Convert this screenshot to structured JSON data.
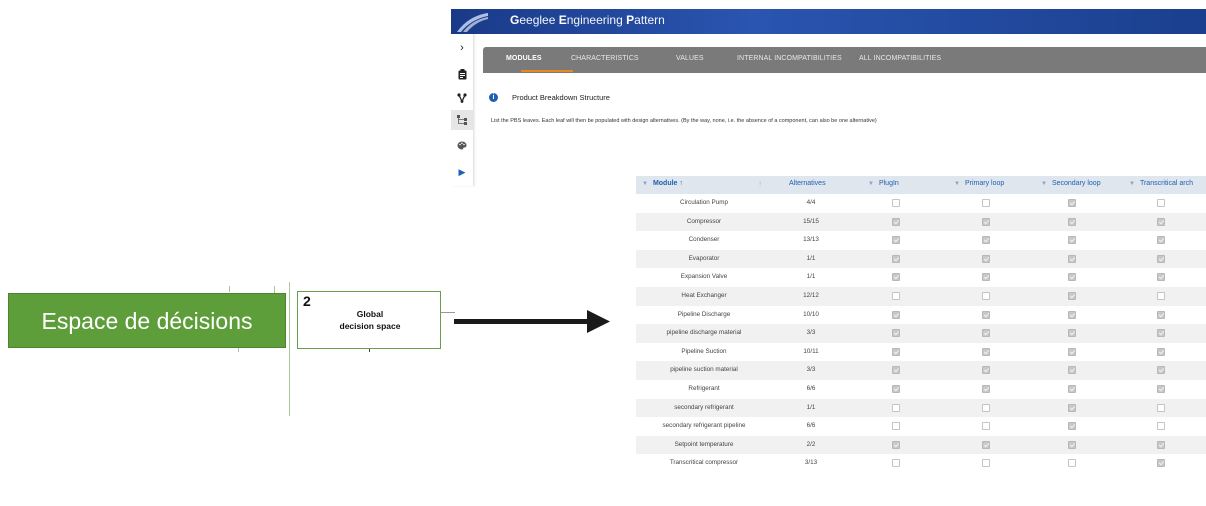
{
  "app": {
    "title_bold_1": "G",
    "title_rest_1": "eeglee ",
    "title_bold_2": "E",
    "title_rest_2": "ngineering ",
    "title_bold_3": "P",
    "title_rest_3": "attern",
    "brand_color": "#1f3f8a"
  },
  "sidebar": {
    "items": [
      {
        "icon": "chevron-right-icon",
        "glyph": "›"
      },
      {
        "icon": "clipboard-icon",
        "glyph": ""
      },
      {
        "icon": "fork-icon",
        "glyph": ""
      },
      {
        "icon": "tree-structure-icon",
        "glyph": ""
      },
      {
        "icon": "palette-icon",
        "glyph": ""
      },
      {
        "icon": "play-icon",
        "glyph": "▶"
      }
    ]
  },
  "tabs": [
    {
      "label": "MODULES",
      "active": true
    },
    {
      "label": "CHARACTERISTICS",
      "active": false
    },
    {
      "label": "VALUES",
      "active": false
    },
    {
      "label": "INTERNAL INCOMPATIBILITIES",
      "active": false
    },
    {
      "label": "ALL INCOMPATIBILITIES",
      "active": false
    }
  ],
  "section": {
    "info_glyph": "i",
    "title": "Product Breakdown Structure",
    "description": "List the PBS leaves. Each leaf will then be populated with design alternatives. (By the way, none, i.e. the absence of a component, can also be one alternative)"
  },
  "grid": {
    "headers": {
      "module": "Module ↑",
      "alternatives": "Alternatives",
      "plugin": "PlugIn",
      "primary": "Primary loop",
      "secondary": "Secondary loop",
      "transcritical": "Transcritical arch"
    },
    "filter_glyph": "▼",
    "sort_glyph": "⁝",
    "rows": [
      {
        "module": "Circulation Pump",
        "alt": "4/4",
        "plugin": false,
        "primary": false,
        "secondary": true,
        "trans": false
      },
      {
        "module": "Compressor",
        "alt": "15/15",
        "plugin": true,
        "primary": true,
        "secondary": true,
        "trans": true
      },
      {
        "module": "Condenser",
        "alt": "13/13",
        "plugin": true,
        "primary": true,
        "secondary": true,
        "trans": true
      },
      {
        "module": "Evaporator",
        "alt": "1/1",
        "plugin": true,
        "primary": true,
        "secondary": true,
        "trans": true
      },
      {
        "module": "Expansion Valve",
        "alt": "1/1",
        "plugin": true,
        "primary": true,
        "secondary": true,
        "trans": true
      },
      {
        "module": "Heat Exchanger",
        "alt": "12/12",
        "plugin": false,
        "primary": false,
        "secondary": true,
        "trans": false
      },
      {
        "module": "Pipeline Discharge",
        "alt": "10/10",
        "plugin": true,
        "primary": true,
        "secondary": true,
        "trans": true
      },
      {
        "module": "pipeline discharge material",
        "alt": "3/3",
        "plugin": true,
        "primary": true,
        "secondary": true,
        "trans": true
      },
      {
        "module": "Pipeline Suction",
        "alt": "10/11",
        "plugin": true,
        "primary": true,
        "secondary": true,
        "trans": true
      },
      {
        "module": "pipeline suction material",
        "alt": "3/3",
        "plugin": true,
        "primary": true,
        "secondary": true,
        "trans": true
      },
      {
        "module": "Refrigerant",
        "alt": "6/6",
        "plugin": true,
        "primary": true,
        "secondary": true,
        "trans": true
      },
      {
        "module": "secondary refrigerant",
        "alt": "1/1",
        "plugin": false,
        "primary": false,
        "secondary": true,
        "trans": false
      },
      {
        "module": "secondary refrigerant pipeline",
        "alt": "6/6",
        "plugin": false,
        "primary": false,
        "secondary": true,
        "trans": false
      },
      {
        "module": "Setpoint temperature",
        "alt": "2/2",
        "plugin": true,
        "primary": true,
        "secondary": true,
        "trans": true
      },
      {
        "module": "Transcritical compressor",
        "alt": "3/13",
        "plugin": false,
        "primary": false,
        "secondary": false,
        "trans": true
      }
    ]
  },
  "diagram": {
    "green_label": "Espace de décisions",
    "step_number": "2",
    "step_line1": "Global",
    "step_line2": "decision space",
    "green_color": "#5e9e3a"
  }
}
